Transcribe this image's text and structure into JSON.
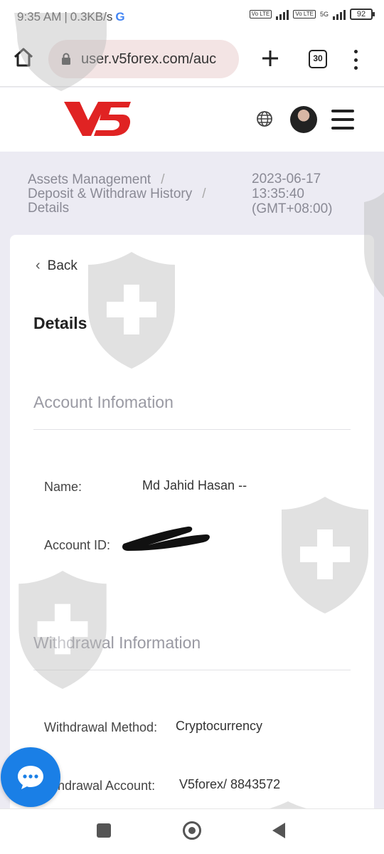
{
  "status_bar": {
    "time": "9:35 AM",
    "speed": "0.3KB/s",
    "g_glyph": "G",
    "volte1": "Vo LTE",
    "volte2": "Vo LTE",
    "network": "5G",
    "battery": "92"
  },
  "browser": {
    "url": "user.v5forex.com/auc",
    "tab_count": "30",
    "icons": [
      "home-icon",
      "lock-icon",
      "plus-icon",
      "tabs-icon",
      "more-vert-icon"
    ]
  },
  "header": {
    "logo_text": "V5",
    "icons": [
      "globe-icon",
      "avatar",
      "hamburger-menu-icon"
    ]
  },
  "breadcrumb": {
    "items": [
      "Assets Management",
      "Deposit & Withdraw History",
      "Details"
    ],
    "separator": "/"
  },
  "datetime": {
    "date": "2023-06-17",
    "time": "13:35:40",
    "tz": "(GMT+08:00)"
  },
  "page": {
    "back_label": "Back",
    "title": "Details"
  },
  "account_section": {
    "title": "Account Infomation",
    "name_label": "Name:",
    "name_value": "Md Jahid Hasan --",
    "id_label": "Account ID:"
  },
  "withdrawal_section": {
    "title": "Withdrawal Information",
    "method_label": "Withdrawal Method:",
    "method_value": "Cryptocurrency",
    "account_label": "thdrawal Account:",
    "account_value": "V5forex/ 8843572"
  },
  "colors": {
    "brand_red": "#e02323",
    "chat_blue": "#1a7fe6",
    "watermark_gray": "#bdbdbd"
  }
}
